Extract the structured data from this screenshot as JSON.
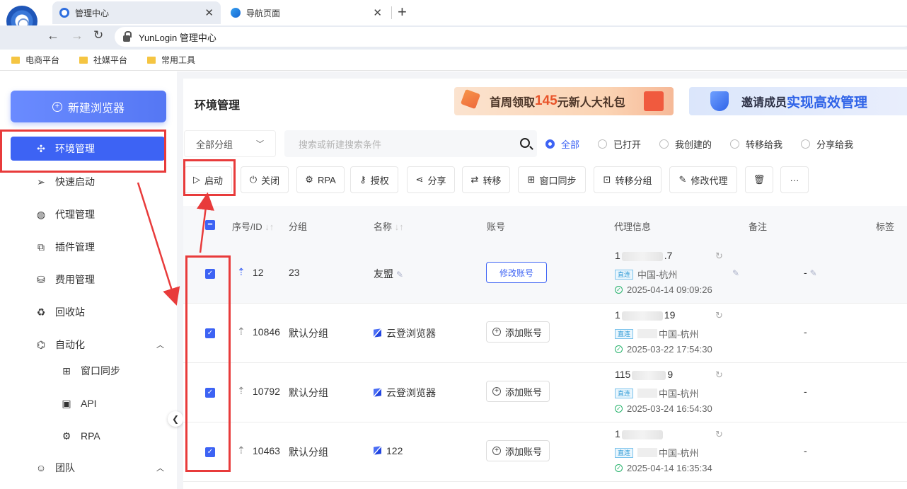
{
  "browser": {
    "tabs": [
      {
        "title": "管理中心",
        "active": true
      },
      {
        "title": "导航页面",
        "active": false
      }
    ],
    "address": "YunLogin 管理中心",
    "bookmarks": [
      "电商平台",
      "社媒平台",
      "常用工具"
    ]
  },
  "sidebar": {
    "new_button": "新建浏览器",
    "items": [
      {
        "label": "环境管理",
        "icon": "cluster-icon"
      },
      {
        "label": "快速启动",
        "icon": "send-icon"
      },
      {
        "label": "代理管理",
        "icon": "globe-icon"
      },
      {
        "label": "插件管理",
        "icon": "puzzle-icon"
      },
      {
        "label": "费用管理",
        "icon": "coins-icon"
      },
      {
        "label": "回收站",
        "icon": "recycle-icon"
      },
      {
        "label": "自动化",
        "icon": "automation-icon"
      },
      {
        "label": "窗口同步",
        "icon": "window-sync-icon"
      },
      {
        "label": "API",
        "icon": "api-icon"
      },
      {
        "label": "RPA",
        "icon": "robot-icon"
      },
      {
        "label": "团队",
        "icon": "team-icon"
      }
    ]
  },
  "main": {
    "title": "环境管理",
    "banner1": {
      "prefix": "首周领取",
      "highlight": "145",
      "suffix": "元新人大礼包"
    },
    "banner2": {
      "prefix": "邀请成员",
      "highlight": "实现高效管理"
    },
    "group_select": "全部分组",
    "search_placeholder": "搜索或新建搜索条件",
    "filters": [
      "全部",
      "已打开",
      "我创建的",
      "转移给我",
      "分享给我"
    ],
    "toolbar": {
      "start": "启动",
      "close": "关闭",
      "rpa": "RPA",
      "authorize": "授权",
      "share": "分享",
      "transfer": "转移",
      "window_sync": "窗口同步",
      "transfer_group": "转移分组",
      "edit_proxy": "修改代理"
    },
    "table": {
      "headers": {
        "id": "序号/ID",
        "group": "分组",
        "name": "名称",
        "account": "账号",
        "proxy": "代理信息",
        "note": "备注",
        "tag": "标签"
      },
      "rows": [
        {
          "id": "12",
          "group": "23",
          "name": "友盟",
          "account": "修改账号",
          "ip_a": "1",
          "ip_b": ".7",
          "conn": "直连",
          "location": "中国-杭州",
          "time": "2025-04-14 09:09:26",
          "note": "-"
        },
        {
          "id": "10846",
          "group": "默认分组",
          "name": "云登浏览器",
          "account": "添加账号",
          "ip_a": "1",
          "ip_b": "19",
          "conn": "直连",
          "location": "中国-杭州",
          "time": "2025-03-22 17:54:30",
          "note": "-"
        },
        {
          "id": "10792",
          "group": "默认分组",
          "name": "云登浏览器",
          "account": "添加账号",
          "ip_a": "115",
          "ip_b": "9",
          "conn": "直连",
          "location": "中国-杭州",
          "time": "2025-03-24 16:54:30",
          "note": "-"
        },
        {
          "id": "10463",
          "group": "默认分组",
          "name": "122",
          "account": "添加账号",
          "ip_a": "1",
          "ip_b": "",
          "conn": "直连",
          "location": "中国-杭州",
          "time": "2025-04-14 16:35:34",
          "note": "-"
        }
      ]
    }
  },
  "colors": {
    "accent": "#3d63f4",
    "annotation": "#e83b3b"
  }
}
